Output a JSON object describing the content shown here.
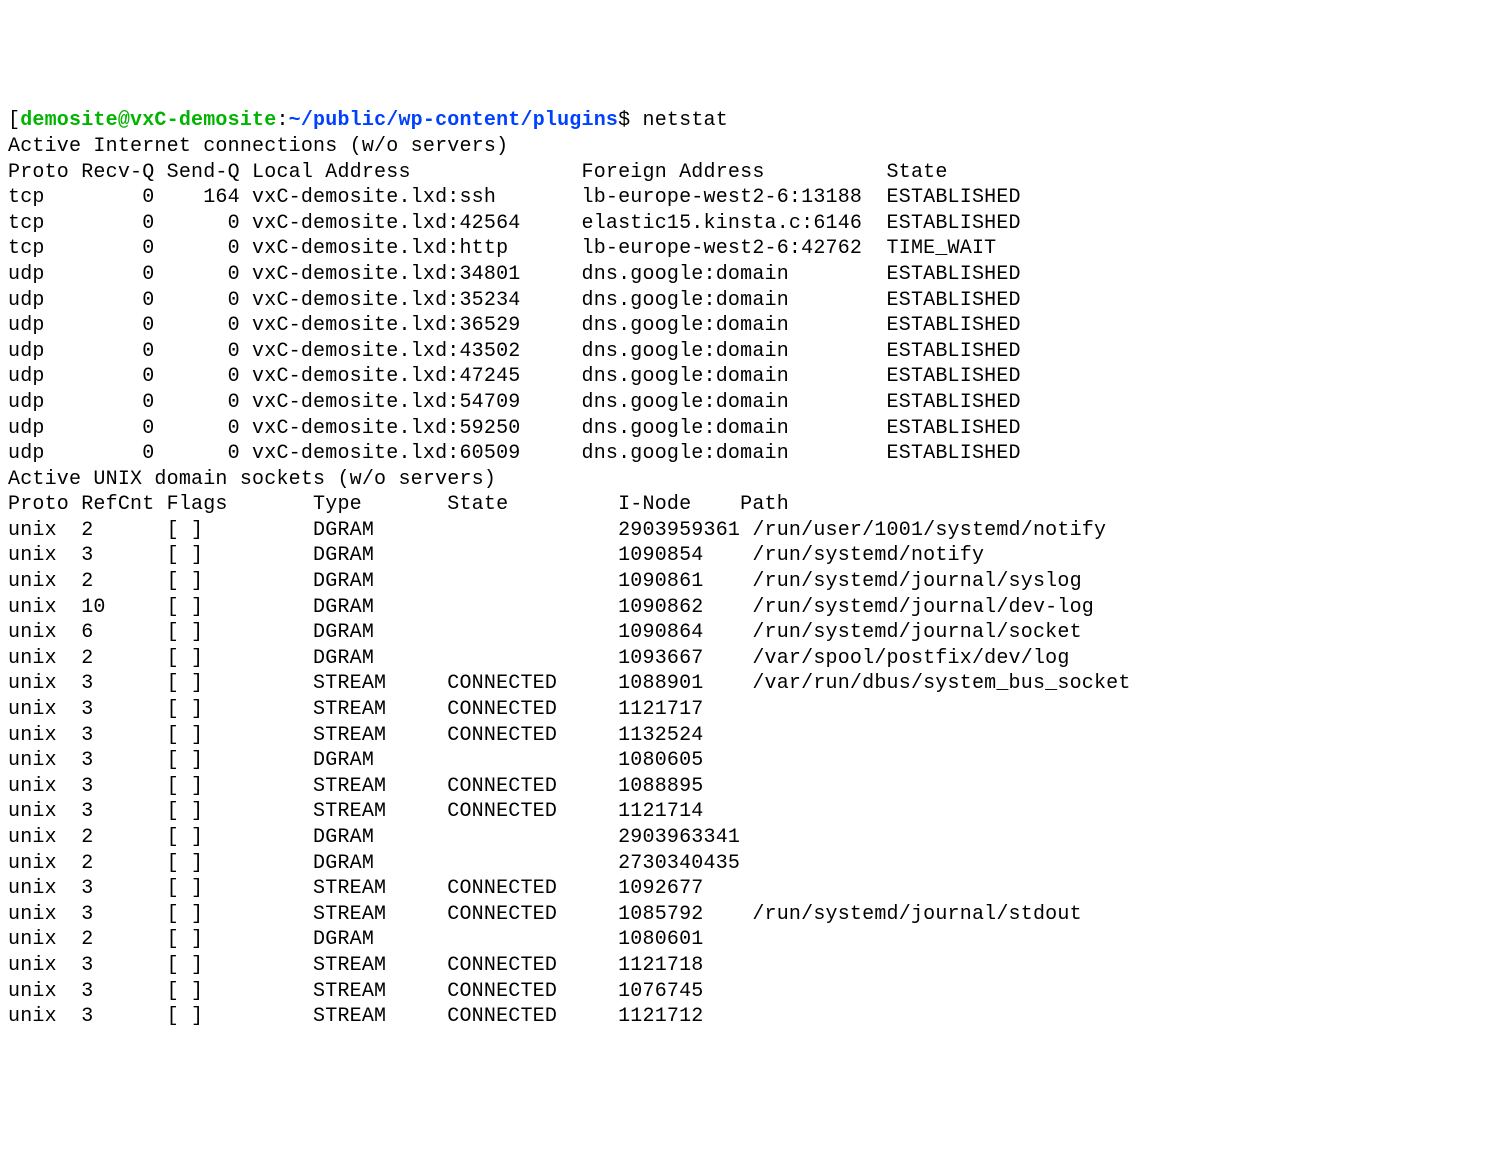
{
  "prompt": {
    "bracket": "[",
    "user_host": "demosite@vxC-demosite",
    "colon": ":",
    "path": "~/public/wp-content/plugins",
    "dollar": "$",
    "command": "netstat"
  },
  "section1_title": "Active Internet connections (w/o servers)",
  "inet_header": {
    "proto": "Proto",
    "recvq": "Recv-Q",
    "sendq": "Send-Q",
    "local": "Local Address",
    "foreign": "Foreign Address",
    "state": "State"
  },
  "inet_rows": [
    {
      "proto": "tcp",
      "recvq": "0",
      "sendq": "164",
      "local": "vxC-demosite.lxd:ssh",
      "foreign": "lb-europe-west2-6:13188",
      "state": "ESTABLISHED"
    },
    {
      "proto": "tcp",
      "recvq": "0",
      "sendq": "0",
      "local": "vxC-demosite.lxd:42564",
      "foreign": "elastic15.kinsta.c:6146",
      "state": "ESTABLISHED"
    },
    {
      "proto": "tcp",
      "recvq": "0",
      "sendq": "0",
      "local": "vxC-demosite.lxd:http",
      "foreign": "lb-europe-west2-6:42762",
      "state": "TIME_WAIT"
    },
    {
      "proto": "udp",
      "recvq": "0",
      "sendq": "0",
      "local": "vxC-demosite.lxd:34801",
      "foreign": "dns.google:domain",
      "state": "ESTABLISHED"
    },
    {
      "proto": "udp",
      "recvq": "0",
      "sendq": "0",
      "local": "vxC-demosite.lxd:35234",
      "foreign": "dns.google:domain",
      "state": "ESTABLISHED"
    },
    {
      "proto": "udp",
      "recvq": "0",
      "sendq": "0",
      "local": "vxC-demosite.lxd:36529",
      "foreign": "dns.google:domain",
      "state": "ESTABLISHED"
    },
    {
      "proto": "udp",
      "recvq": "0",
      "sendq": "0",
      "local": "vxC-demosite.lxd:43502",
      "foreign": "dns.google:domain",
      "state": "ESTABLISHED"
    },
    {
      "proto": "udp",
      "recvq": "0",
      "sendq": "0",
      "local": "vxC-demosite.lxd:47245",
      "foreign": "dns.google:domain",
      "state": "ESTABLISHED"
    },
    {
      "proto": "udp",
      "recvq": "0",
      "sendq": "0",
      "local": "vxC-demosite.lxd:54709",
      "foreign": "dns.google:domain",
      "state": "ESTABLISHED"
    },
    {
      "proto": "udp",
      "recvq": "0",
      "sendq": "0",
      "local": "vxC-demosite.lxd:59250",
      "foreign": "dns.google:domain",
      "state": "ESTABLISHED"
    },
    {
      "proto": "udp",
      "recvq": "0",
      "sendq": "0",
      "local": "vxC-demosite.lxd:60509",
      "foreign": "dns.google:domain",
      "state": "ESTABLISHED"
    }
  ],
  "section2_title": "Active UNIX domain sockets (w/o servers)",
  "unix_header": {
    "proto": "Proto",
    "refcnt": "RefCnt",
    "flags": "Flags",
    "type": "Type",
    "state": "State",
    "inode": "I-Node",
    "path": "Path"
  },
  "unix_rows": [
    {
      "proto": "unix",
      "refcnt": "2",
      "flags": "[ ]",
      "type": "DGRAM",
      "state": "",
      "inode": "2903959361",
      "path": "/run/user/1001/systemd/notify"
    },
    {
      "proto": "unix",
      "refcnt": "3",
      "flags": "[ ]",
      "type": "DGRAM",
      "state": "",
      "inode": "1090854",
      "path": "/run/systemd/notify"
    },
    {
      "proto": "unix",
      "refcnt": "2",
      "flags": "[ ]",
      "type": "DGRAM",
      "state": "",
      "inode": "1090861",
      "path": "/run/systemd/journal/syslog"
    },
    {
      "proto": "unix",
      "refcnt": "10",
      "flags": "[ ]",
      "type": "DGRAM",
      "state": "",
      "inode": "1090862",
      "path": "/run/systemd/journal/dev-log"
    },
    {
      "proto": "unix",
      "refcnt": "6",
      "flags": "[ ]",
      "type": "DGRAM",
      "state": "",
      "inode": "1090864",
      "path": "/run/systemd/journal/socket"
    },
    {
      "proto": "unix",
      "refcnt": "2",
      "flags": "[ ]",
      "type": "DGRAM",
      "state": "",
      "inode": "1093667",
      "path": "/var/spool/postfix/dev/log"
    },
    {
      "proto": "unix",
      "refcnt": "3",
      "flags": "[ ]",
      "type": "STREAM",
      "state": "CONNECTED",
      "inode": "1088901",
      "path": "/var/run/dbus/system_bus_socket"
    },
    {
      "proto": "unix",
      "refcnt": "3",
      "flags": "[ ]",
      "type": "STREAM",
      "state": "CONNECTED",
      "inode": "1121717",
      "path": ""
    },
    {
      "proto": "unix",
      "refcnt": "3",
      "flags": "[ ]",
      "type": "STREAM",
      "state": "CONNECTED",
      "inode": "1132524",
      "path": ""
    },
    {
      "proto": "unix",
      "refcnt": "3",
      "flags": "[ ]",
      "type": "DGRAM",
      "state": "",
      "inode": "1080605",
      "path": ""
    },
    {
      "proto": "unix",
      "refcnt": "3",
      "flags": "[ ]",
      "type": "STREAM",
      "state": "CONNECTED",
      "inode": "1088895",
      "path": ""
    },
    {
      "proto": "unix",
      "refcnt": "3",
      "flags": "[ ]",
      "type": "STREAM",
      "state": "CONNECTED",
      "inode": "1121714",
      "path": ""
    },
    {
      "proto": "unix",
      "refcnt": "2",
      "flags": "[ ]",
      "type": "DGRAM",
      "state": "",
      "inode": "2903963341",
      "path": ""
    },
    {
      "proto": "unix",
      "refcnt": "2",
      "flags": "[ ]",
      "type": "DGRAM",
      "state": "",
      "inode": "2730340435",
      "path": ""
    },
    {
      "proto": "unix",
      "refcnt": "3",
      "flags": "[ ]",
      "type": "STREAM",
      "state": "CONNECTED",
      "inode": "1092677",
      "path": ""
    },
    {
      "proto": "unix",
      "refcnt": "3",
      "flags": "[ ]",
      "type": "STREAM",
      "state": "CONNECTED",
      "inode": "1085792",
      "path": "/run/systemd/journal/stdout"
    },
    {
      "proto": "unix",
      "refcnt": "2",
      "flags": "[ ]",
      "type": "DGRAM",
      "state": "",
      "inode": "1080601",
      "path": ""
    },
    {
      "proto": "unix",
      "refcnt": "3",
      "flags": "[ ]",
      "type": "STREAM",
      "state": "CONNECTED",
      "inode": "1121718",
      "path": ""
    },
    {
      "proto": "unix",
      "refcnt": "3",
      "flags": "[ ]",
      "type": "STREAM",
      "state": "CONNECTED",
      "inode": "1076745",
      "path": ""
    },
    {
      "proto": "unix",
      "refcnt": "3",
      "flags": "[ ]",
      "type": "STREAM",
      "state": "CONNECTED",
      "inode": "1121712",
      "path": ""
    }
  ]
}
